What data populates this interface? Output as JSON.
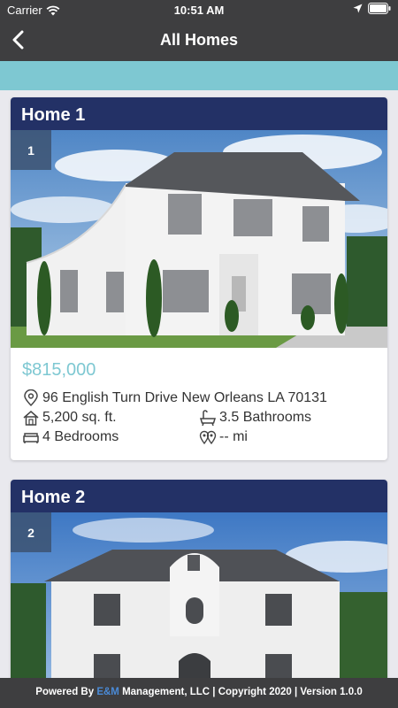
{
  "status_bar": {
    "carrier": "Carrier",
    "time": "10:51 AM"
  },
  "nav": {
    "title": "All Homes"
  },
  "homes": [
    {
      "title": "Home 1",
      "badge": "1",
      "price": "$815,000",
      "address": "96 English Turn Drive New Orleans LA 70131",
      "sqft": "5,200 sq. ft.",
      "bathrooms": "3.5 Bathrooms",
      "bedrooms": "4 Bedrooms",
      "distance": "-- mi"
    },
    {
      "title": "Home 2",
      "badge": "2"
    }
  ],
  "footer": {
    "prefix": "Powered By ",
    "brand": "E&M",
    "suffix": " Management, LLC | Copyright 2020 | Version 1.0.0"
  },
  "colors": {
    "nav_bg": "#3e3e40",
    "accent": "#7ec8d2",
    "card_header": "#233166"
  }
}
